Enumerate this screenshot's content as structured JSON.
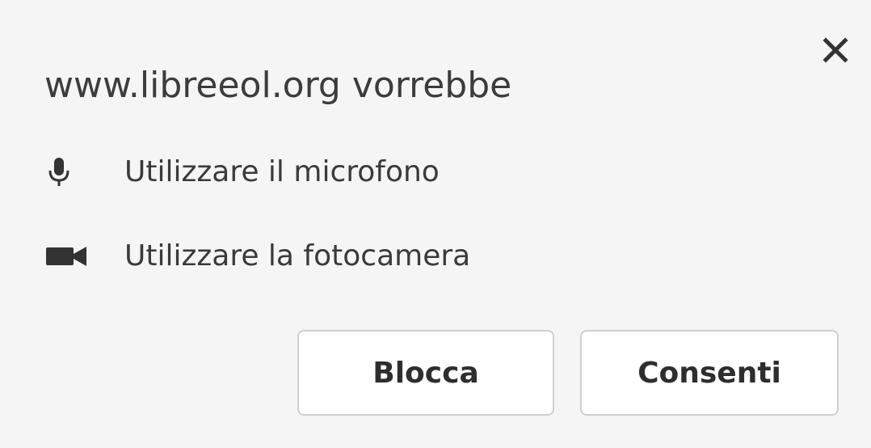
{
  "dialog": {
    "title": "www.libreeol.org vorrebbe",
    "close_icon": "close-icon",
    "permissions": [
      {
        "icon": "microphone-icon",
        "label": "Utilizzare il microfono"
      },
      {
        "icon": "camera-icon",
        "label": "Utilizzare la fotocamera"
      }
    ],
    "buttons": {
      "block_label": "Blocca",
      "allow_label": "Consenti"
    }
  },
  "colors": {
    "background": "#f5f5f5",
    "text": "#333333",
    "button_border": "#cfcfcf",
    "button_background": "#ffffff"
  }
}
